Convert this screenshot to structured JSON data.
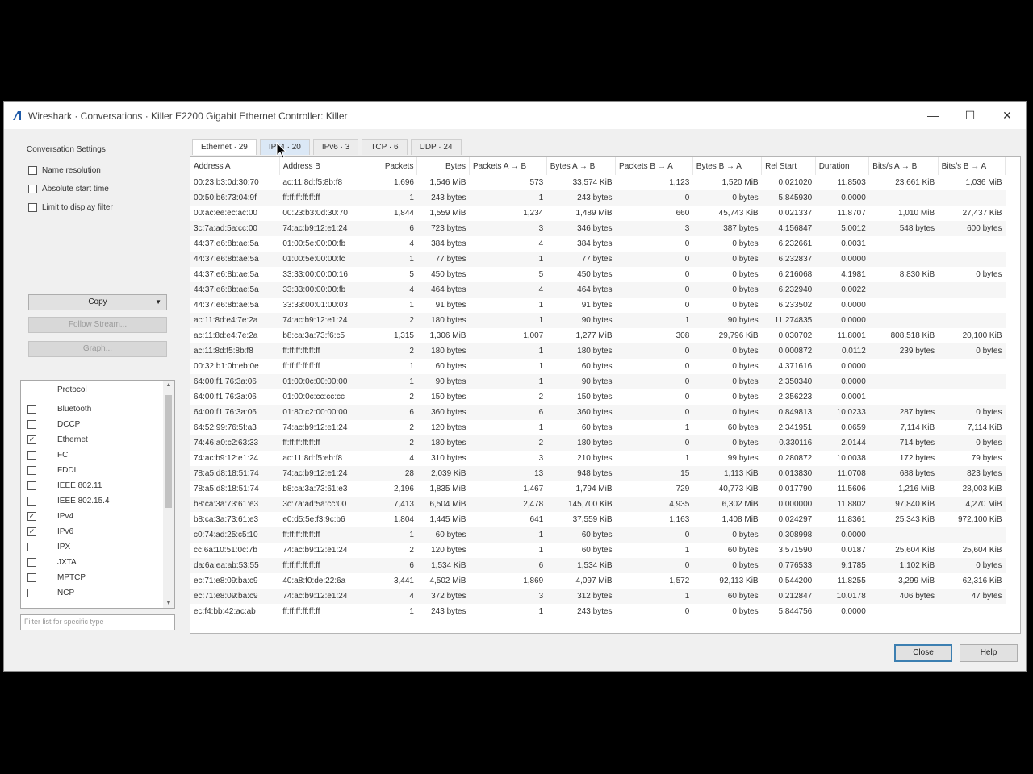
{
  "window": {
    "title": "Wireshark · Conversations · Killer E2200 Gigabit Ethernet Controller: Killer",
    "min_glyph": "—",
    "max_glyph": "☐",
    "close_glyph": "✕"
  },
  "settings": {
    "label": "Conversation Settings",
    "checkboxes": [
      {
        "label": "Name resolution",
        "checked": false
      },
      {
        "label": "Absolute start time",
        "checked": false
      },
      {
        "label": "Limit to display filter",
        "checked": false
      }
    ],
    "copy_label": "Copy",
    "follow_label": "Follow Stream...",
    "graph_label": "Graph..."
  },
  "protocols": {
    "header": "Protocol",
    "items": [
      {
        "name": "Bluetooth",
        "checked": false
      },
      {
        "name": "DCCP",
        "checked": false
      },
      {
        "name": "Ethernet",
        "checked": true
      },
      {
        "name": "FC",
        "checked": false
      },
      {
        "name": "FDDI",
        "checked": false
      },
      {
        "name": "IEEE 802.11",
        "checked": false
      },
      {
        "name": "IEEE 802.15.4",
        "checked": false
      },
      {
        "name": "IPv4",
        "checked": true
      },
      {
        "name": "IPv6",
        "checked": true
      },
      {
        "name": "IPX",
        "checked": false
      },
      {
        "name": "JXTA",
        "checked": false
      },
      {
        "name": "MPTCP",
        "checked": false
      },
      {
        "name": "NCP",
        "checked": false
      }
    ],
    "filter_placeholder": "Filter list for specific type"
  },
  "tabs": [
    "Ethernet · 29",
    "IPv4 · 20",
    "IPv6 · 3",
    "TCP · 6",
    "UDP · 24"
  ],
  "table": {
    "headers": [
      "Address A",
      "Address B",
      "Packets",
      "Bytes",
      "Packets A → B",
      "Bytes A → B",
      "Packets B → A",
      "Bytes B → A",
      "Rel Start",
      "Duration",
      "Bits/s A → B",
      "Bits/s B → A"
    ],
    "rows": [
      [
        "00:23:b3:0d:30:70",
        "ac:11:8d:f5:8b:f8",
        "1,696",
        "1,546 MiB",
        "573",
        "33,574 KiB",
        "1,123",
        "1,520 MiB",
        "0.021020",
        "11.8503",
        "23,661 KiB",
        "1,036 MiB"
      ],
      [
        "00:50:b6:73:04:9f",
        "ff:ff:ff:ff:ff:ff",
        "1",
        "243 bytes",
        "1",
        "243 bytes",
        "0",
        "0 bytes",
        "5.845930",
        "0.0000",
        "",
        ""
      ],
      [
        "00:ac:ee:ec:ac:00",
        "00:23:b3:0d:30:70",
        "1,844",
        "1,559 MiB",
        "1,234",
        "1,489 MiB",
        "660",
        "45,743 KiB",
        "0.021337",
        "11.8707",
        "1,010 MiB",
        "27,437 KiB"
      ],
      [
        "3c:7a:ad:5a:cc:00",
        "74:ac:b9:12:e1:24",
        "6",
        "723 bytes",
        "3",
        "346 bytes",
        "3",
        "387 bytes",
        "4.156847",
        "5.0012",
        "548 bytes",
        "600 bytes"
      ],
      [
        "44:37:e6:8b:ae:5a",
        "01:00:5e:00:00:fb",
        "4",
        "384 bytes",
        "4",
        "384 bytes",
        "0",
        "0 bytes",
        "6.232661",
        "0.0031",
        "",
        ""
      ],
      [
        "44:37:e6:8b:ae:5a",
        "01:00:5e:00:00:fc",
        "1",
        "77 bytes",
        "1",
        "77 bytes",
        "0",
        "0 bytes",
        "6.232837",
        "0.0000",
        "",
        ""
      ],
      [
        "44:37:e6:8b:ae:5a",
        "33:33:00:00:00:16",
        "5",
        "450 bytes",
        "5",
        "450 bytes",
        "0",
        "0 bytes",
        "6.216068",
        "4.1981",
        "8,830 KiB",
        "0 bytes"
      ],
      [
        "44:37:e6:8b:ae:5a",
        "33:33:00:00:00:fb",
        "4",
        "464 bytes",
        "4",
        "464 bytes",
        "0",
        "0 bytes",
        "6.232940",
        "0.0022",
        "",
        ""
      ],
      [
        "44:37:e6:8b:ae:5a",
        "33:33:00:01:00:03",
        "1",
        "91 bytes",
        "1",
        "91 bytes",
        "0",
        "0 bytes",
        "6.233502",
        "0.0000",
        "",
        ""
      ],
      [
        "ac:11:8d:e4:7e:2a",
        "74:ac:b9:12:e1:24",
        "2",
        "180 bytes",
        "1",
        "90 bytes",
        "1",
        "90 bytes",
        "11.274835",
        "0.0000",
        "",
        ""
      ],
      [
        "ac:11:8d:e4:7e:2a",
        "b8:ca:3a:73:f6:c5",
        "1,315",
        "1,306 MiB",
        "1,007",
        "1,277 MiB",
        "308",
        "29,796 KiB",
        "0.030702",
        "11.8001",
        "808,518 KiB",
        "20,100 KiB"
      ],
      [
        "ac:11:8d:f5:8b:f8",
        "ff:ff:ff:ff:ff:ff",
        "2",
        "180 bytes",
        "1",
        "180 bytes",
        "0",
        "0 bytes",
        "0.000872",
        "0.0112",
        "239 bytes",
        "0 bytes"
      ],
      [
        "00:32:b1:0b:eb:0e",
        "ff:ff:ff:ff:ff:ff",
        "1",
        "60 bytes",
        "1",
        "60 bytes",
        "0",
        "0 bytes",
        "4.371616",
        "0.0000",
        "",
        ""
      ],
      [
        "64:00:f1:76:3a:06",
        "01:00:0c:00:00:00",
        "1",
        "90 bytes",
        "1",
        "90 bytes",
        "0",
        "0 bytes",
        "2.350340",
        "0.0000",
        "",
        ""
      ],
      [
        "64:00:f1:76:3a:06",
        "01:00:0c:cc:cc:cc",
        "2",
        "150 bytes",
        "2",
        "150 bytes",
        "0",
        "0 bytes",
        "2.356223",
        "0.0001",
        "",
        ""
      ],
      [
        "64:00:f1:76:3a:06",
        "01:80:c2:00:00:00",
        "6",
        "360 bytes",
        "6",
        "360 bytes",
        "0",
        "0 bytes",
        "0.849813",
        "10.0233",
        "287 bytes",
        "0 bytes"
      ],
      [
        "64:52:99:76:5f:a3",
        "74:ac:b9:12:e1:24",
        "2",
        "120 bytes",
        "1",
        "60 bytes",
        "1",
        "60 bytes",
        "2.341951",
        "0.0659",
        "7,114 KiB",
        "7,114 KiB"
      ],
      [
        "74:46:a0:c2:63:33",
        "ff:ff:ff:ff:ff:ff",
        "2",
        "180 bytes",
        "2",
        "180 bytes",
        "0",
        "0 bytes",
        "0.330116",
        "2.0144",
        "714 bytes",
        "0 bytes"
      ],
      [
        "74:ac:b9:12:e1:24",
        "ac:11:8d:f5:eb:f8",
        "4",
        "310 bytes",
        "3",
        "210 bytes",
        "1",
        "99 bytes",
        "0.280872",
        "10.0038",
        "172 bytes",
        "79 bytes"
      ],
      [
        "78:a5:d8:18:51:74",
        "74:ac:b9:12:e1:24",
        "28",
        "2,039 KiB",
        "13",
        "948 bytes",
        "15",
        "1,113 KiB",
        "0.013830",
        "11.0708",
        "688 bytes",
        "823 bytes"
      ],
      [
        "78:a5:d8:18:51:74",
        "b8:ca:3a:73:61:e3",
        "2,196",
        "1,835 MiB",
        "1,467",
        "1,794 MiB",
        "729",
        "40,773 KiB",
        "0.017790",
        "11.5606",
        "1,216 MiB",
        "28,003 KiB"
      ],
      [
        "b8:ca:3a:73:61:e3",
        "3c:7a:ad:5a:cc:00",
        "7,413",
        "6,504 MiB",
        "2,478",
        "145,700 KiB",
        "4,935",
        "6,302 MiB",
        "0.000000",
        "11.8802",
        "97,840 KiB",
        "4,270 MiB"
      ],
      [
        "b8:ca:3a:73:61:e3",
        "e0:d5:5e:f3:9c:b6",
        "1,804",
        "1,445 MiB",
        "641",
        "37,559 KiB",
        "1,163",
        "1,408 MiB",
        "0.024297",
        "11.8361",
        "25,343 KiB",
        "972,100 KiB"
      ],
      [
        "c0:74:ad:25:c5:10",
        "ff:ff:ff:ff:ff:ff",
        "1",
        "60 bytes",
        "1",
        "60 bytes",
        "0",
        "0 bytes",
        "0.308998",
        "0.0000",
        "",
        ""
      ],
      [
        "cc:6a:10:51:0c:7b",
        "74:ac:b9:12:e1:24",
        "2",
        "120 bytes",
        "1",
        "60 bytes",
        "1",
        "60 bytes",
        "3.571590",
        "0.0187",
        "25,604 KiB",
        "25,604 KiB"
      ],
      [
        "da:6a:ea:ab:53:55",
        "ff:ff:ff:ff:ff:ff",
        "6",
        "1,534 KiB",
        "6",
        "1,534 KiB",
        "0",
        "0 bytes",
        "0.776533",
        "9.1785",
        "1,102 KiB",
        "0 bytes"
      ],
      [
        "ec:71:e8:09:ba:c9",
        "40:a8:f0:de:22:6a",
        "3,441",
        "4,502 MiB",
        "1,869",
        "4,097 MiB",
        "1,572",
        "92,113 KiB",
        "0.544200",
        "11.8255",
        "3,299 MiB",
        "62,316 KiB"
      ],
      [
        "ec:71:e8:09:ba:c9",
        "74:ac:b9:12:e1:24",
        "4",
        "372 bytes",
        "3",
        "312 bytes",
        "1",
        "60 bytes",
        "0.212847",
        "10.0178",
        "406 bytes",
        "47 bytes"
      ],
      [
        "ec:f4:bb:42:ac:ab",
        "ff:ff:ff:ff:ff:ff",
        "1",
        "243 bytes",
        "1",
        "243 bytes",
        "0",
        "0 bytes",
        "5.844756",
        "0.0000",
        "",
        ""
      ]
    ]
  },
  "buttons": {
    "close_label": "Close",
    "help_label": "Help"
  },
  "colors": {
    "accent": "#3c7fb1",
    "wireshark_blue": "#1e5aa8"
  }
}
